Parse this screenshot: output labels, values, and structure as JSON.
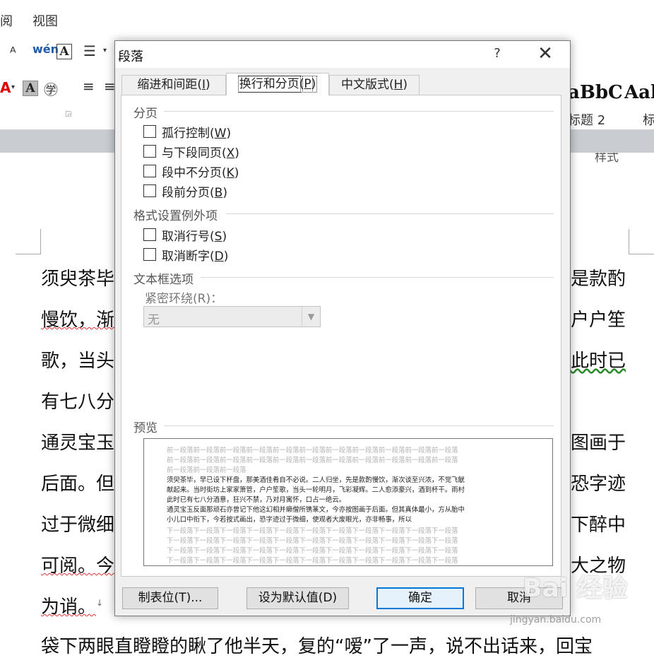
{
  "ribbon_tabs": [
    "阅",
    "视图"
  ],
  "ribbon": {
    "styles_group_label": "样式",
    "style_samples": [
      "aBbC",
      "Aal"
    ],
    "style_names": [
      "标题 2",
      "标"
    ]
  },
  "document": {
    "lines": [
      {
        "left": "须臾茶毕",
        "right": "是款酌"
      },
      {
        "left": "慢饮，渐",
        "right": "户户笙"
      },
      {
        "left": "歌，当头",
        "right": "此时已"
      },
      {
        "left": "有七八分",
        "right": ""
      },
      {
        "left": "通灵宝玉",
        "right": "图画于"
      },
      {
        "left": "后面。但",
        "right": "恐字迹"
      },
      {
        "left": "过于微细",
        "right": "下醉中"
      },
      {
        "left": "可阅。今",
        "right": "大之物"
      },
      {
        "left": "为诮。",
        "right": ""
      }
    ],
    "paragraph_mark": "↓",
    "bottom_line": "袋下两眼直瞪瞪的瞅了他半天，复的“嗳”了一声，说不出话来，回宝"
  },
  "dialog": {
    "title": "段落",
    "help": "?",
    "close": "✕",
    "tabs": [
      {
        "label": "缩进和间距",
        "key": "I"
      },
      {
        "label": "换行和分页",
        "key": "P"
      },
      {
        "label": "中文版式",
        "key": "H"
      }
    ],
    "sections": {
      "pagination": {
        "title": "分页",
        "options": [
          {
            "label": "孤行控制",
            "key": "W",
            "checked": false
          },
          {
            "label": "与下段同页",
            "key": "X",
            "checked": false
          },
          {
            "label": "段中不分页",
            "key": "K",
            "checked": false
          },
          {
            "label": "段前分页",
            "key": "B",
            "checked": false
          }
        ]
      },
      "exceptions": {
        "title": "格式设置例外项",
        "options": [
          {
            "label": "取消行号",
            "key": "S",
            "checked": false
          },
          {
            "label": "取消断字",
            "key": "D",
            "checked": false
          }
        ]
      },
      "textbox": {
        "title": "文本框选项",
        "wrap_label": "紧密环绕(R)：",
        "wrap_value": "无"
      },
      "preview": {
        "title": "预览",
        "prev_lines": [
          "前一段落前一段落前一段落前一段落前一段落前一段落前一段落前一段落前一段落前一段落前一段落",
          "前一段落前一段落前一段落前一段落前一段落前一段落前一段落前一段落前一段落前一段落前一段落",
          "前一段落前一段落前一段落"
        ],
        "body_lines": [
          "须臾茶毕，早已设下杯盘，那美酒佳肴自不必说。二人归坐，先是款酌慢饮，渐次谈至兴浓，不觉飞觥",
          "献起来。当时街坊上家家箫管，户户笙歌，当头一轮明月，飞彩凝辉。二人愈添豪兴，酒到杯干。雨村",
          "此时已有七八分酒意，狂兴不禁，乃对月寓怀，口占一绝云。",
          "通灵宝玉反面那顽石亦曾记下他这幻相并癞僧所镌篆文，今亦按图画于后面。但其真体最小，方从胎中",
          "小儿口中衔下，今若按式画出，恐字迹过于微细，使观者大废眼光，亦非畅事，所以"
        ],
        "next_lines": [
          "下一段落下一段落下一段落下一段落下一段落下一段落下一段落下一段落下一段落下一段落下一段落",
          "下一段落下一段落下一段落下一段落下一段落下一段落下一段落下一段落下一段落下一段落下一段落",
          "下一段落下一段落下一段落下一段落下一段落下一段落下一段落下一段落下一段落下一段落下一段落",
          "下一段落下一段落下一段落下一段落下一段落下一段落下一段落下一段落下一段落下一段落下一段落"
        ]
      }
    },
    "buttons": {
      "tabs": "制表位(T)...",
      "set_default": "设为默认值(D)",
      "ok": "确定",
      "cancel": "取消"
    }
  },
  "watermark": {
    "logo": "Bai 经验",
    "url": "jingyan.baidu.com"
  }
}
